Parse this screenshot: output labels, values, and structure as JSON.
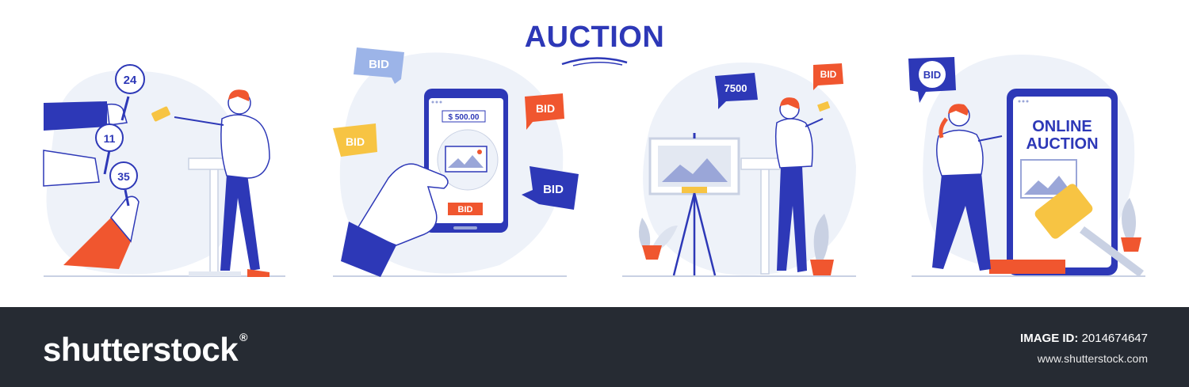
{
  "title": "AUCTION",
  "scene1": {
    "paddles": [
      "24",
      "11",
      "35"
    ]
  },
  "scene2": {
    "price": "$ 500.00",
    "screen_button": "BID",
    "bubbles": [
      "BID",
      "BID",
      "BID",
      "BID"
    ]
  },
  "scene3": {
    "bubble_amount": "7500",
    "bubble_bid": "BID"
  },
  "scene4": {
    "bubble": "BID",
    "screen_line1": "ONLINE",
    "screen_line2": "AUCTION"
  },
  "footer": {
    "logo": "shutterstock",
    "image_id_label": "IMAGE ID:",
    "image_id_value": "2014674647",
    "site": "www.shutterstock.com"
  },
  "colors": {
    "primary_blue": "#2d38b7",
    "light_blue_bg": "#eef2f9",
    "orange": "#f0562f",
    "yellow": "#f7c443",
    "footer_bg": "#262b33"
  }
}
